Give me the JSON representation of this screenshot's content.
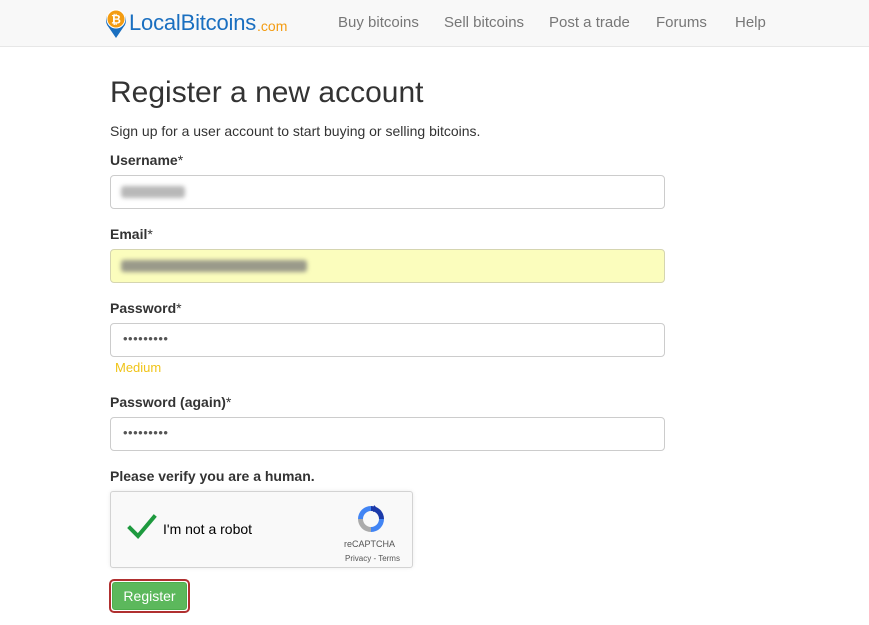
{
  "brand": {
    "name": "LocalBitcoins",
    "tld": ".com",
    "icon": "bitcoin-pin-icon"
  },
  "nav": {
    "items": [
      {
        "label": "Buy bitcoins"
      },
      {
        "label": "Sell bitcoins"
      },
      {
        "label": "Post a trade"
      },
      {
        "label": "Forums"
      },
      {
        "label": "Help"
      }
    ]
  },
  "page": {
    "title": "Register a new account",
    "subtitle": "Sign up for a user account to start buying or selling bitcoins."
  },
  "form": {
    "username": {
      "label": "Username",
      "required_mark": "*"
    },
    "email": {
      "label": "Email",
      "required_mark": "*"
    },
    "password": {
      "label": "Password",
      "required_mark": "*",
      "masked_value": "•••••••••",
      "strength": "Medium"
    },
    "password_again": {
      "label": "Password (again)",
      "required_mark": "*",
      "masked_value": "•••••••••"
    }
  },
  "captcha": {
    "prompt": "Please verify you are a human.",
    "checkbox_label": "I'm not a robot",
    "checked": true,
    "brand": "reCAPTCHA",
    "links": "Privacy - Terms"
  },
  "register_button": {
    "label": "Register"
  },
  "colors": {
    "brand_blue": "#1a6fc0",
    "brand_orange": "#f39c12",
    "autofill_bg": "#fbfdbd",
    "strength_medium": "#f0c419",
    "button_green": "#5cb85c",
    "focus_red": "#b03030"
  }
}
